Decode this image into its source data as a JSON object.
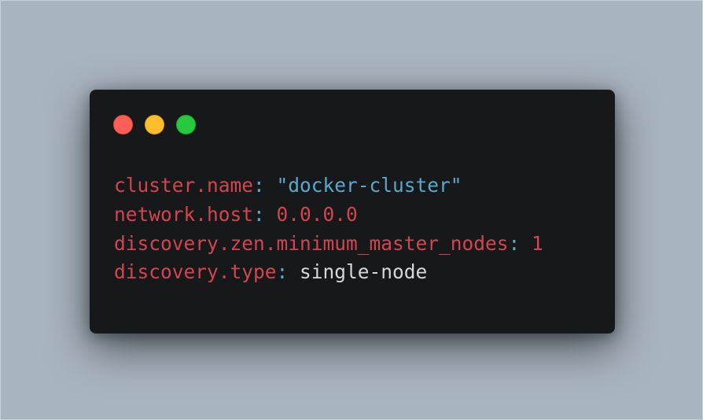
{
  "window": {
    "buttons": {
      "close": "close",
      "minimize": "minimize",
      "maximize": "maximize"
    }
  },
  "code": {
    "lines": [
      {
        "key": "cluster.name",
        "sep": ": ",
        "value": "\"docker-cluster\"",
        "kind": "string"
      },
      {
        "key": "network.host",
        "sep": ": ",
        "value": "0.0.0.0",
        "kind": "number"
      },
      {
        "key": "discovery.zen.minimum_master_nodes",
        "sep": ": ",
        "value": "1",
        "kind": "number"
      },
      {
        "key": "discovery.type",
        "sep": ": ",
        "value": "single-node",
        "kind": "plain"
      }
    ]
  },
  "colors": {
    "background": "#a8b4c0",
    "window": "#17181a",
    "key": "#d3454e",
    "string": "#59a8cd",
    "plain": "#d7d7d7",
    "close": "#ff5f56",
    "minimize": "#ffbd2e",
    "maximize": "#27c93f"
  }
}
